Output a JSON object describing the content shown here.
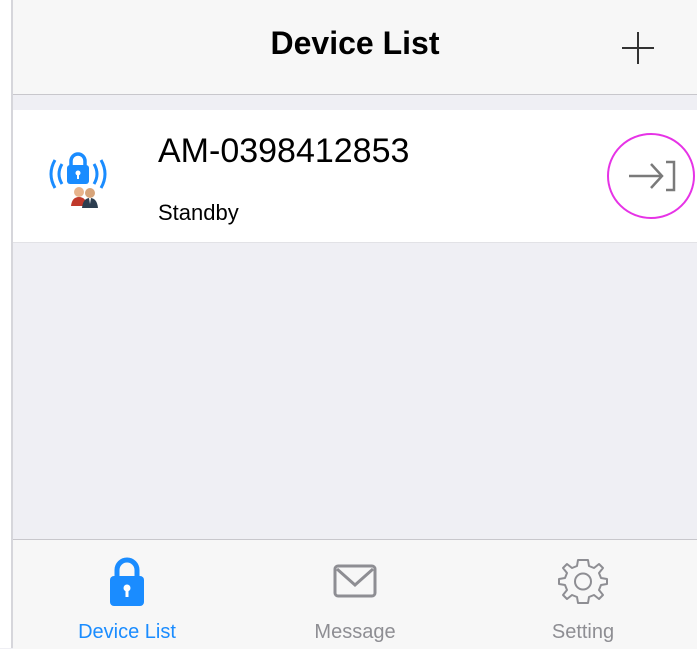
{
  "header": {
    "title": "Device List",
    "add_icon": "plus-icon"
  },
  "devices": [
    {
      "name": "AM-0398412853",
      "status": "Standby",
      "icon": "wireless-lock-users-icon",
      "action_icon": "enter-arrow-icon"
    }
  ],
  "tabbar": {
    "tabs": [
      {
        "label": "Device List",
        "icon": "lock-icon",
        "active": true
      },
      {
        "label": "Message",
        "icon": "envelope-icon",
        "active": false
      },
      {
        "label": "Setting",
        "icon": "gear-icon",
        "active": false
      }
    ]
  },
  "colors": {
    "accent": "#1a8cff",
    "inactive": "#8e8e93",
    "highlight_circle": "#e633e6",
    "background": "#efeff4"
  }
}
